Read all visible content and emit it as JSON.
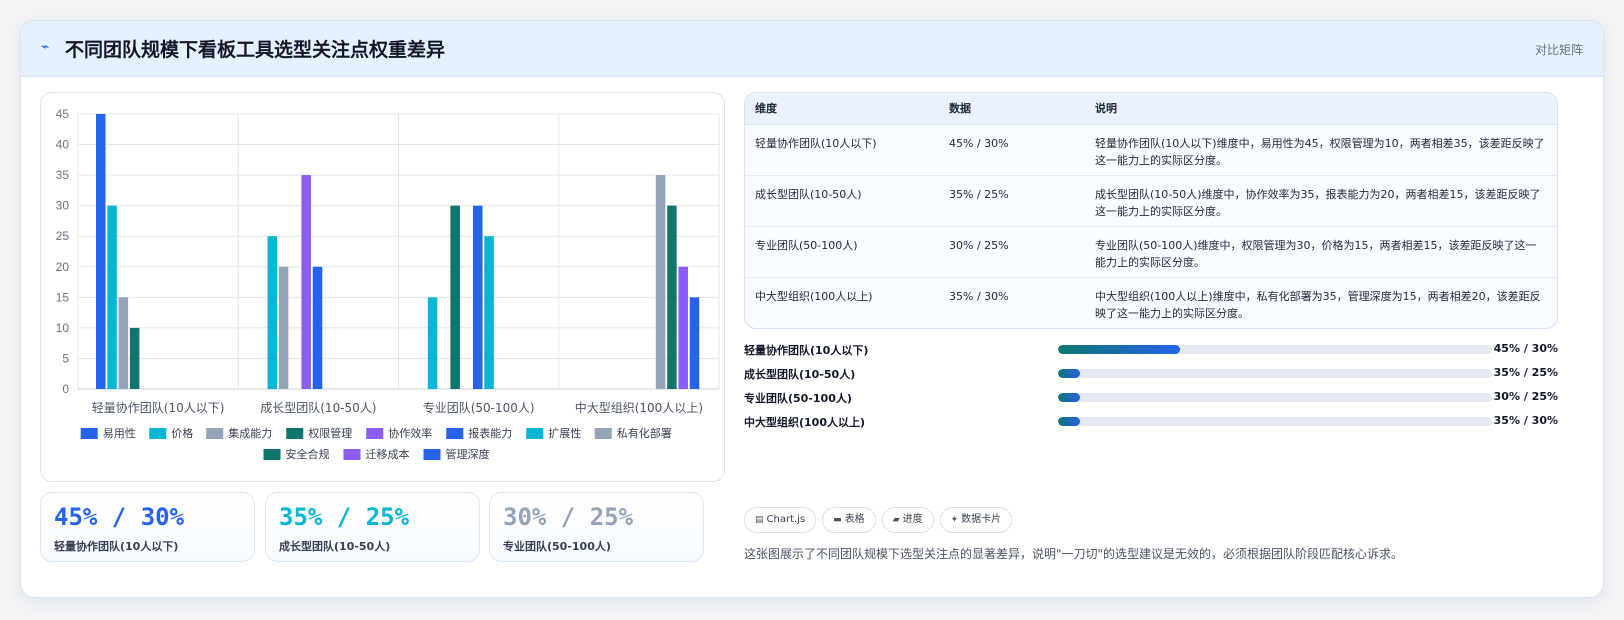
{
  "header": {
    "icon": "lightning-icon",
    "title": "不同团队规模下看板工具选型关注点权重差异",
    "tag": "对比矩阵"
  },
  "chart_data": {
    "type": "bar",
    "categories": [
      "轻量协作团队(10人以下)",
      "成长型团队(10-50人)",
      "专业团队(50-100人)",
      "中大型组织(100人以上)"
    ],
    "ylim": [
      0,
      45
    ],
    "yticks": [
      0,
      5,
      10,
      15,
      20,
      25,
      30,
      35,
      40,
      45
    ],
    "grid": true,
    "legend_position": "bottom",
    "series": [
      {
        "name": "易用性",
        "color": "#2563eb",
        "values": [
          45,
          null,
          null,
          null
        ]
      },
      {
        "name": "价格",
        "color": "#06b6d4",
        "values": [
          30,
          25,
          null,
          null
        ]
      },
      {
        "name": "集成能力",
        "color": "#94a3b8",
        "values": [
          15,
          20,
          null,
          null
        ]
      },
      {
        "name": "权限管理",
        "color": "#0f766e",
        "values": [
          10,
          null,
          30,
          null
        ]
      },
      {
        "name": "协作效率",
        "color": "#8b5cf6",
        "values": [
          null,
          35,
          null,
          null
        ]
      },
      {
        "name": "报表能力",
        "color": "#2563eb",
        "values": [
          null,
          20,
          30,
          null
        ]
      },
      {
        "name": "扩展性",
        "color": "#06b6d4",
        "values": [
          null,
          null,
          25,
          null
        ]
      },
      {
        "name": "私有化部署",
        "color": "#94a3b8",
        "values": [
          null,
          null,
          null,
          35
        ]
      },
      {
        "name": "安全合规",
        "color": "#0f766e",
        "values": [
          null,
          null,
          null,
          30
        ]
      },
      {
        "name": "迁移成本",
        "color": "#8b5cf6",
        "values": [
          null,
          null,
          null,
          20
        ]
      },
      {
        "name": "管理深度",
        "color": "#2563eb",
        "values": [
          null,
          null,
          null,
          15
        ]
      }
    ],
    "extra_bars": [
      {
        "category_index": 2,
        "value": 15,
        "color": "#06b6d4"
      }
    ]
  },
  "stats": [
    {
      "value": "45% / 30%",
      "label": "轻量协作团队(10人以下)",
      "color": "#2563eb"
    },
    {
      "value": "35% / 25%",
      "label": "成长型团队(10-50人)",
      "color": "#06b6d4"
    },
    {
      "value": "30% / 25%",
      "label": "专业团队(50-100人)",
      "color": "#94a3b8"
    }
  ],
  "table": {
    "headers": [
      "维度",
      "数据",
      "说明"
    ],
    "rows": [
      {
        "dim": "轻量协作团队(10人以下)",
        "data": "45% / 30%",
        "desc": "轻量协作团队(10人以下)维度中，易用性为45，权限管理为10，两者相差35，该差距反映了这一能力上的实际区分度。"
      },
      {
        "dim": "成长型团队(10-50人)",
        "data": "35% / 25%",
        "desc": "成长型团队(10-50人)维度中，协作效率为35，报表能力为20，两者相差15，该差距反映了这一能力上的实际区分度。"
      },
      {
        "dim": "专业团队(50-100人)",
        "data": "30% / 25%",
        "desc": "专业团队(50-100人)维度中，权限管理为30，价格为15，两者相差15，该差距反映了这一能力上的实际区分度。"
      },
      {
        "dim": "中大型组织(100人以上)",
        "data": "35% / 30%",
        "desc": "中大型组织(100人以上)维度中，私有化部署为35，管理深度为15，两者相差20，该差距反映了这一能力上的实际区分度。"
      }
    ]
  },
  "progress": [
    {
      "label": "轻量协作团队(10人以下)",
      "value": "45% / 30%",
      "fill": 0.28
    },
    {
      "label": "成长型团队(10-50人)",
      "value": "35% / 25%",
      "fill": 0.05
    },
    {
      "label": "专业团队(50-100人)",
      "value": "30% / 25%",
      "fill": 0.05
    },
    {
      "label": "中大型组织(100人以上)",
      "value": "35% / 30%",
      "fill": 0.05
    }
  ],
  "chips": [
    {
      "icon": "chart-icon",
      "glyph": "▤",
      "label": "Chart.js"
    },
    {
      "icon": "table-icon",
      "glyph": "▬",
      "label": "表格"
    },
    {
      "icon": "progress-icon",
      "glyph": "▰",
      "label": "进度"
    },
    {
      "icon": "sparkle-icon",
      "glyph": "✦",
      "label": "数据卡片"
    }
  ],
  "note": "这张图展示了不同团队规模下选型关注点的显著差异，说明\"一刀切\"的选型建议是无效的，必须根据团队阶段匹配核心诉求。"
}
